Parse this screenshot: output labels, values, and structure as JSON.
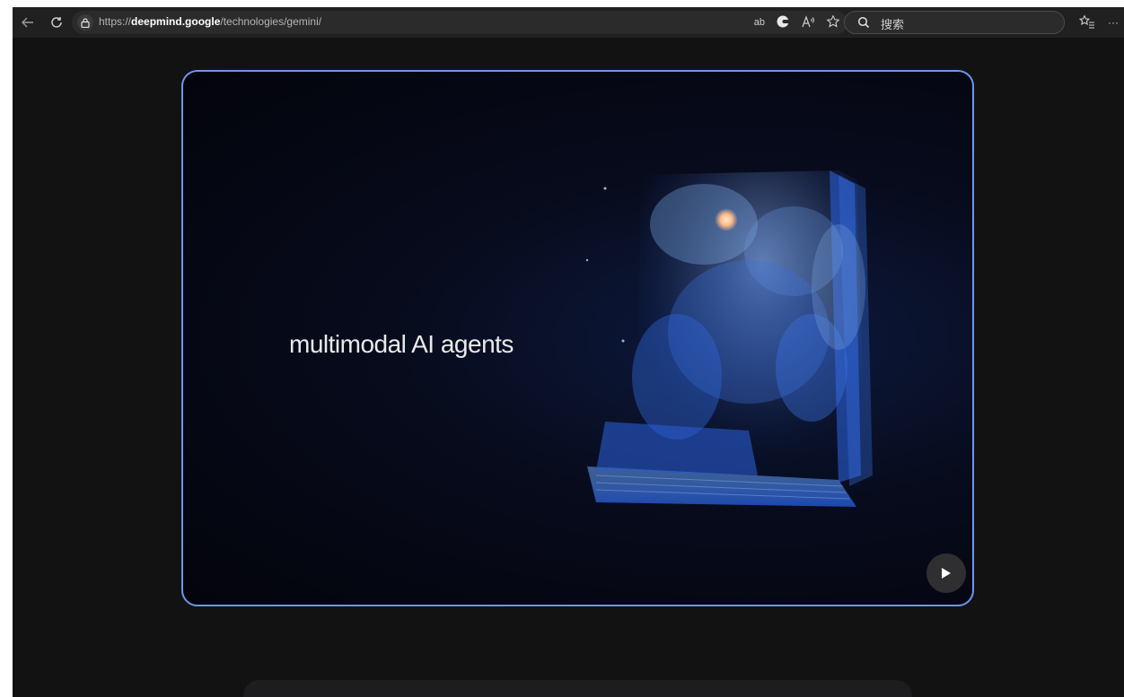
{
  "browser": {
    "url_prefix": "https://",
    "url_domain": "deepmind.google",
    "url_path": "/technologies/gemini/",
    "search_placeholder": "搜索",
    "translate_glyph": "ab",
    "more_glyph": "···"
  },
  "video": {
    "headline": "multimodal AI agents"
  },
  "colors": {
    "accent_border": "#6f95ef",
    "page_background": "#121212",
    "toolbar_background": "#202020"
  },
  "icons": [
    "back-arrow-icon",
    "refresh-icon",
    "lock-icon",
    "translate-icon",
    "copilot-icon",
    "read-aloud-icon",
    "favorite-star-icon",
    "search-icon",
    "favorites-list-icon",
    "more-icon",
    "play-icon"
  ]
}
